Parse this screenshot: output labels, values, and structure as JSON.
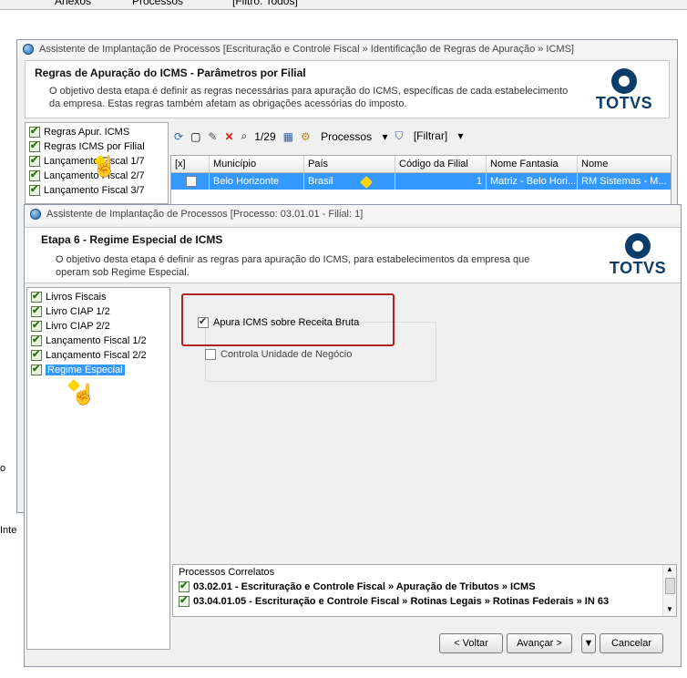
{
  "topbar": {
    "items": [
      "Anexos",
      "Processos",
      "[Filtro: Todos]"
    ]
  },
  "back_window": {
    "title": "Assistente de Implantação de Processos [Escrituração e Controle Fiscal » Identificação de Regras de Apuração » ICMS]",
    "header_title": "Regras de Apuração do ICMS - Parâmetros por Filial",
    "header_desc": "O objetivo desta etapa é definir as regras necessárias para apuração do ICMS, específicas de cada estabelecimento da empresa. Estas regras também afetam as obrigações acessórias do imposto.",
    "nav": [
      "Regras Apur. ICMS",
      "Regras ICMS por Filial",
      "Lançamento Fiscal 1/7",
      "Lançamento Fiscal 2/7",
      "Lançamento Fiscal 3/7"
    ],
    "toolbar": {
      "counter": "1/29",
      "processos": "Processos",
      "filtrar": "[Filtrar]"
    },
    "grid_headers": [
      "[x]",
      "Município",
      "País",
      "Código da Filial",
      "Nome Fantasia",
      "Nome"
    ],
    "grid_row": [
      "",
      "Belo Horizonte",
      "Brasil",
      "1",
      "Matriz - Belo Hori...",
      "RM Sistemas - M..."
    ]
  },
  "left_fragments": {
    "frag1": "o",
    "frag2": "Inte"
  },
  "front_window": {
    "title": "Assistente de Implantação de Processos [Processo: 03.01.01 - Filial: 1]",
    "header_title": "Etapa 6 - Regime Especial de ICMS",
    "header_desc": "O objetivo desta etapa é definir as regras para apuração do ICMS, para estabelecimentos da empresa que operam sob Regime Especial.",
    "logo": "TOTVS",
    "nav": [
      "Livros Fiscais",
      "Livro CIAP 1/2",
      "Livro CIAP 2/2",
      "Lançamento Fiscal 1/2",
      "Lançamento Fiscal 2/2",
      "Regime Especial"
    ],
    "options": {
      "apura": "Apura ICMS sobre Receita Bruta",
      "controla": "Controla Unidade de Negócio"
    },
    "related": {
      "title": "Processos Correlatos",
      "items": [
        "03.02.01 - Escrituração e Controle Fiscal » Apuração de Tributos » ICMS",
        "03.04.01.05 - Escrituração e Controle Fiscal » Rotinas Legais » Rotinas Federais » IN 63"
      ]
    },
    "buttons": {
      "voltar": "< Voltar",
      "avancar": "Avançar >",
      "cancelar": "Cancelar"
    }
  },
  "colors": {
    "accent": "#3399ff",
    "brand": "#0b3d6b",
    "highlight_box": "#b22222"
  }
}
